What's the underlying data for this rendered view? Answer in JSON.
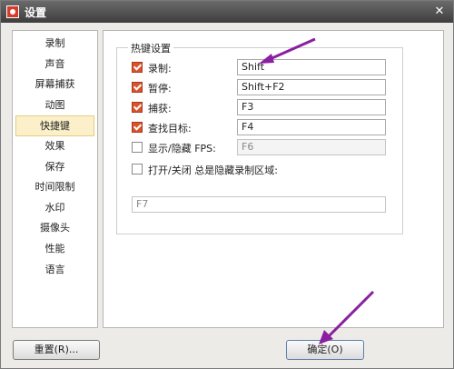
{
  "window": {
    "title": "设置"
  },
  "sidebar": {
    "items": [
      {
        "label": "录制"
      },
      {
        "label": "声音"
      },
      {
        "label": "屏幕捕获"
      },
      {
        "label": "动图"
      },
      {
        "label": "快捷键",
        "active": true
      },
      {
        "label": "效果"
      },
      {
        "label": "保存"
      },
      {
        "label": "时间限制"
      },
      {
        "label": "水印"
      },
      {
        "label": "摄像头"
      },
      {
        "label": "性能"
      },
      {
        "label": "语言"
      }
    ]
  },
  "hotkeys": {
    "group_title": "热键设置",
    "rows": [
      {
        "label": "录制:",
        "value": "Shift",
        "checked": true
      },
      {
        "label": "暂停:",
        "value": "Shift+F2",
        "checked": true
      },
      {
        "label": "捕获:",
        "value": "F3",
        "checked": true
      },
      {
        "label": "查找目标:",
        "value": "F4",
        "checked": true
      },
      {
        "label": "显示/隐藏 FPS:",
        "value": "F6",
        "checked": false
      }
    ],
    "toggle_hidden_area": {
      "label": "打开/关闭 总是隐藏录制区域:",
      "value": "F7",
      "checked": false
    }
  },
  "buttons": {
    "reset_label": "重置(R)...",
    "ok_label": "确定(O)"
  },
  "colors": {
    "accent_checkbox": "#d9532c",
    "annotation_arrow": "#8a1fa0",
    "active_item_bg": "#fbf0c9"
  }
}
